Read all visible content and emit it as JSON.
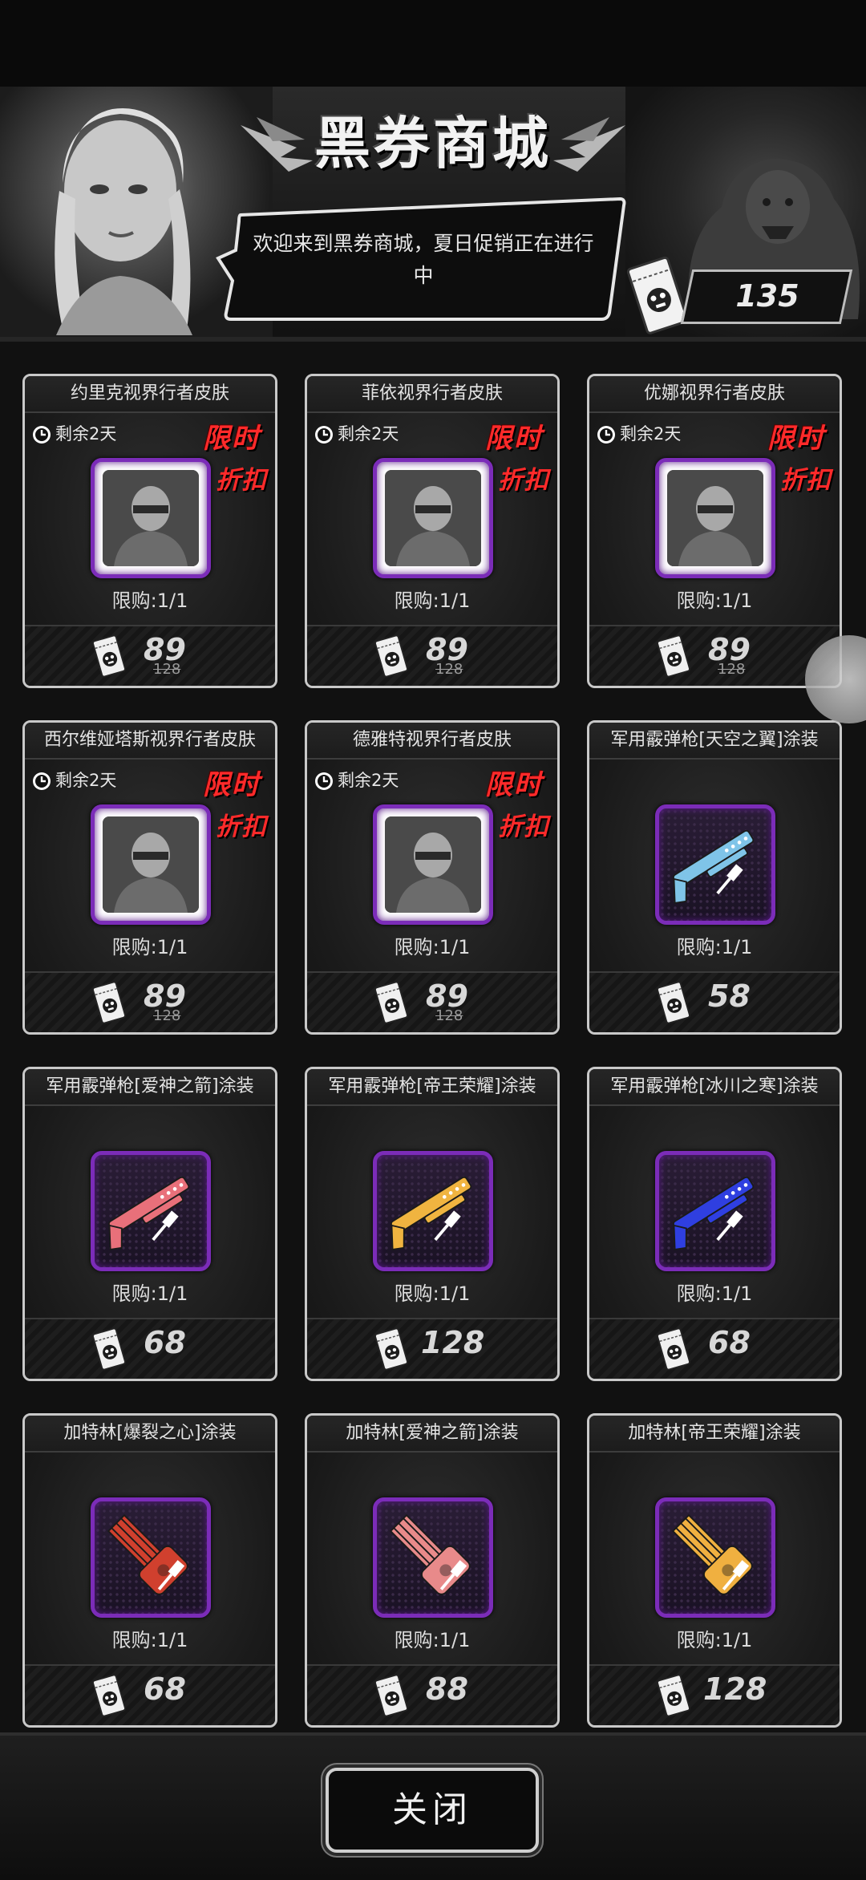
{
  "shop": {
    "title": "黑券商城",
    "greeting": "欢迎来到黑券商城，夏日促销正在进行中",
    "currency_balance": "135",
    "currency_icon": "black-ticket-icon"
  },
  "labels": {
    "limited": "限时",
    "discount": "折扣",
    "close": "关闭"
  },
  "items": [
    {
      "name": "约里克视界行者皮肤",
      "timer": "剩余2天",
      "limit": "限购:1/1",
      "price": "89",
      "original_price": "128",
      "type": "skin",
      "gun_color": ""
    },
    {
      "name": "菲依视界行者皮肤",
      "timer": "剩余2天",
      "limit": "限购:1/1",
      "price": "89",
      "original_price": "128",
      "type": "skin",
      "gun_color": ""
    },
    {
      "name": "优娜视界行者皮肤",
      "timer": "剩余2天",
      "limit": "限购:1/1",
      "price": "89",
      "original_price": "128",
      "type": "skin",
      "gun_color": ""
    },
    {
      "name": "西尔维娅塔斯视界行者皮肤",
      "timer": "剩余2天",
      "limit": "限购:1/1",
      "price": "89",
      "original_price": "128",
      "type": "skin",
      "gun_color": ""
    },
    {
      "name": "德雅特视界行者皮肤",
      "timer": "剩余2天",
      "limit": "限购:1/1",
      "price": "89",
      "original_price": "128",
      "type": "skin",
      "gun_color": ""
    },
    {
      "name": "军用霰弹枪[天空之翼]涂装",
      "timer": "",
      "limit": "限购:1/1",
      "price": "58",
      "original_price": "",
      "type": "shotgun",
      "gun_color": "#7fc4e8"
    },
    {
      "name": "军用霰弹枪[爱神之箭]涂装",
      "timer": "",
      "limit": "限购:1/1",
      "price": "68",
      "original_price": "",
      "type": "shotgun",
      "gun_color": "#e8707a"
    },
    {
      "name": "军用霰弹枪[帝王荣耀]涂装",
      "timer": "",
      "limit": "限购:1/1",
      "price": "128",
      "original_price": "",
      "type": "shotgun",
      "gun_color": "#f0b440"
    },
    {
      "name": "军用霰弹枪[冰川之寒]涂装",
      "timer": "",
      "limit": "限购:1/1",
      "price": "68",
      "original_price": "",
      "type": "shotgun",
      "gun_color": "#2f3fe0"
    },
    {
      "name": "加特林[爆裂之心]涂装",
      "timer": "",
      "limit": "限购:1/1",
      "price": "68",
      "original_price": "",
      "type": "gatling",
      "gun_color": "#d0402e"
    },
    {
      "name": "加特林[爱神之箭]涂装",
      "timer": "",
      "limit": "限购:1/1",
      "price": "88",
      "original_price": "",
      "type": "gatling",
      "gun_color": "#e88a8a"
    },
    {
      "name": "加特林[帝王荣耀]涂装",
      "timer": "",
      "limit": "限购:1/1",
      "price": "128",
      "original_price": "",
      "type": "gatling",
      "gun_color": "#f0b040"
    }
  ]
}
